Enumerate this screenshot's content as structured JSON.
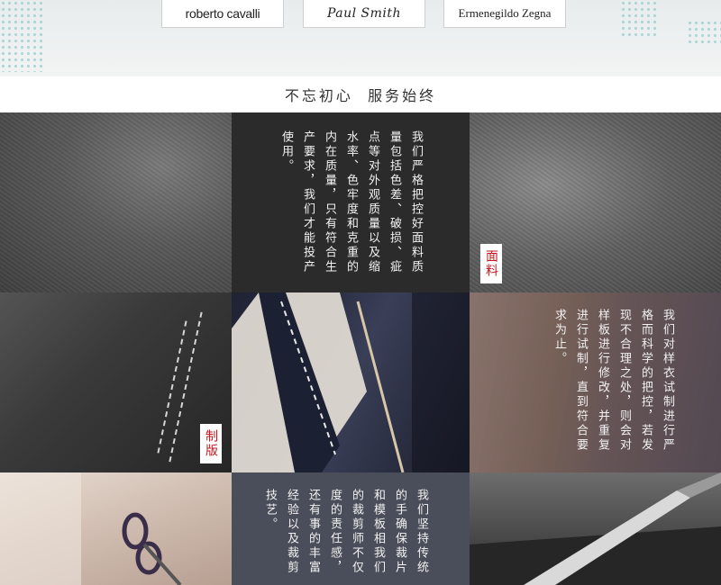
{
  "brands": [
    {
      "name": "roberto cavalli"
    },
    {
      "name": "Paul Smith"
    },
    {
      "name": "Ermenegildo Zegna"
    }
  ],
  "tagline": "不忘初心  服务始终",
  "sections": {
    "fabric": {
      "tag": "面料",
      "text": "我们严格把控好面料质量包括色差、破损、疵点等对外观质量以及缩水率、色牢度和克重的内在质量，只有符合生产要求，我们才能投产使用。"
    },
    "pattern": {
      "tag": "制版",
      "text": "我们对样衣试制进行严格而科学的把控，若发现不合理之处，则会对样板进行修改，并重复进行试制，直到符合要求为止。"
    },
    "cutting": {
      "text": "我们坚持传统的手确保裁片和模板相我们的裁剪师不仅度的责任感，还有事的丰富经验以及裁剪技艺。"
    }
  },
  "colors": {
    "accent_red": "#c8161d",
    "dot_teal": "#9fcfcf"
  }
}
